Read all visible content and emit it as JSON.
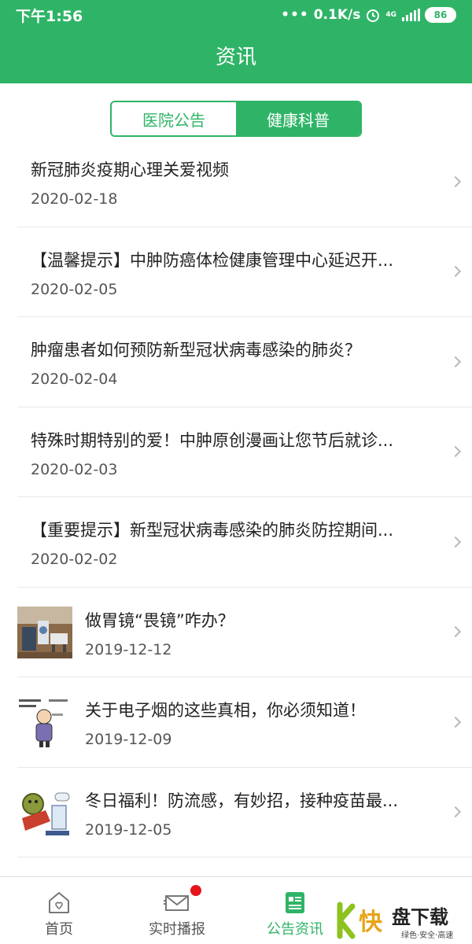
{
  "status_bar": {
    "time": "下午1:56",
    "network_speed": "0.1K/s",
    "network_type": "4G",
    "battery": "86"
  },
  "header": {
    "title": "资讯"
  },
  "segments": [
    {
      "label": "医院公告",
      "active": false
    },
    {
      "label": "健康科普",
      "active": true
    }
  ],
  "articles": [
    {
      "title": "新冠肺炎疫期心理关爱视频",
      "date": "2020-02-18",
      "thumbnail": null
    },
    {
      "title": "【温馨提示】中肿防癌体检健康管理中心延迟开...",
      "date": "2020-02-05",
      "thumbnail": null
    },
    {
      "title": "肿瘤患者如何预防新型冠状病毒感染的肺炎？",
      "date": "2020-02-04",
      "thumbnail": null
    },
    {
      "title": "特殊时期特别的爱！中肿原创漫画让您节后就诊...",
      "date": "2020-02-03",
      "thumbnail": null
    },
    {
      "title": "【重要提示】新型冠状病毒感染的肺炎防控期间...",
      "date": "2020-02-02",
      "thumbnail": null
    },
    {
      "title": "做胃镜“畏镜”咋办？",
      "date": "2019-12-12",
      "thumbnail": "endoscopy-room-photo"
    },
    {
      "title": "关于电子烟的这些真相，你必须知道！",
      "date": "2019-12-09",
      "thumbnail": "e-cigarette-cartoon"
    },
    {
      "title": "冬日福利！防流感，有妙招，接种疫苗最...",
      "date": "2019-12-05",
      "thumbnail": "flu-vaccine-cartoon"
    }
  ],
  "tabbar": {
    "items": [
      {
        "label": "首页",
        "icon": "home-icon",
        "active": false
      },
      {
        "label": "实时播报",
        "icon": "mail-icon",
        "active": false,
        "badge": true
      },
      {
        "label": "公告资讯",
        "icon": "news-icon",
        "active": true
      },
      {
        "label": "",
        "icon": "profile-icon",
        "active": false
      }
    ]
  },
  "watermark": {
    "brand": "快盘下载",
    "tagline": "绿色·安全·高速"
  },
  "colors": {
    "primary": "#2fb467",
    "badge": "#e5141a",
    "divider": "#e8e8e8"
  }
}
